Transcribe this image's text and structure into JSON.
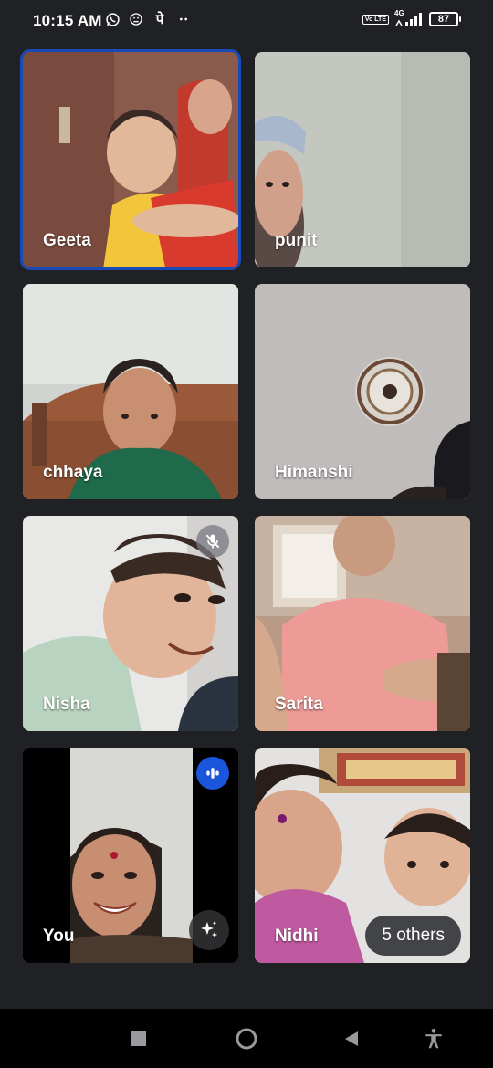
{
  "status_bar": {
    "time": "10:15 AM",
    "left_icons": [
      "whatsapp-icon",
      "smiley-icon",
      "devanagari-app-icon",
      "more-dots-icon"
    ],
    "devanagari_glyph": "पे",
    "volte": "Vo LTE",
    "network": "4G",
    "battery": "87"
  },
  "participants": [
    {
      "name": "Geeta",
      "active_speaker": true
    },
    {
      "name": "punit"
    },
    {
      "name": "chhaya"
    },
    {
      "name": "Himanshi"
    },
    {
      "name": "Nisha",
      "muted": true
    },
    {
      "name": "Sarita"
    },
    {
      "name": "You",
      "speaking": true,
      "effects_button": true
    },
    {
      "name": "Nidhi"
    }
  ],
  "others_chip": "5 others",
  "colors": {
    "background": "#202124",
    "active_outline": "#1a4ab8",
    "speaking_badge": "#1a56db"
  },
  "nav_bar": [
    "square-recents-icon",
    "circle-home-icon",
    "triangle-back-icon",
    "accessibility-icon"
  ]
}
